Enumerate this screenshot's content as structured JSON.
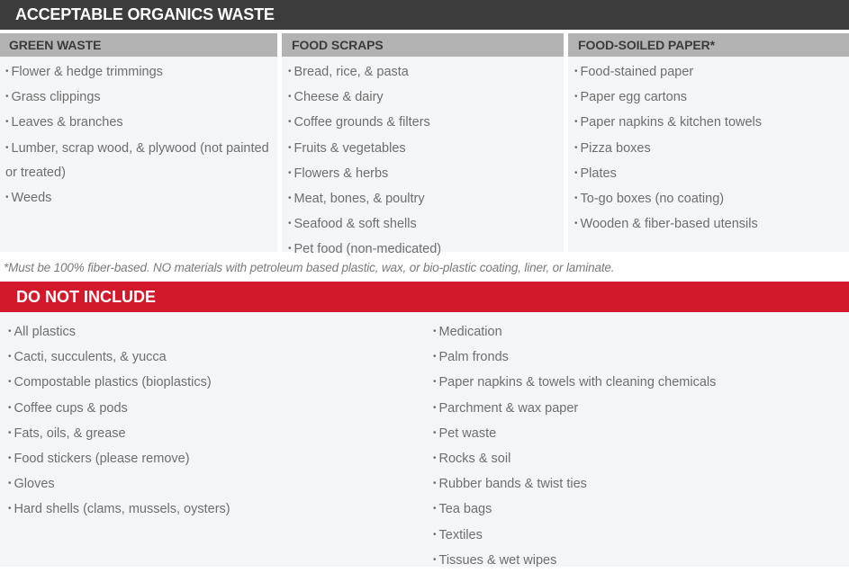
{
  "acceptable": {
    "title": "ACCEPTABLE ORGANICS WASTE",
    "header_color": "#3c3c3c",
    "columns": [
      {
        "heading": "GREEN WASTE",
        "items": [
          "Flower & hedge trimmings",
          "Grass clippings",
          "Leaves & branches",
          "Lumber, scrap wood, & plywood (not painted or treated)",
          "Weeds"
        ]
      },
      {
        "heading": "FOOD SCRAPS",
        "items": [
          "Bread, rice, & pasta",
          "Cheese & dairy",
          "Coffee grounds & filters",
          "Fruits & vegetables",
          "Flowers & herbs",
          "Meat, bones, & poultry",
          "Seafood & soft shells",
          "Pet food (non-medicated)"
        ]
      },
      {
        "heading": "FOOD-SOILED PAPER*",
        "items": [
          "Food-stained paper",
          "Paper egg cartons",
          "Paper napkins & kitchen towels",
          "Pizza boxes",
          "Plates",
          "To-go boxes (no coating)",
          "Wooden & fiber-based utensils"
        ]
      }
    ],
    "footnote": "*Must be 100% fiber-based. NO materials with petroleum based plastic, wax, or bio-plastic coating, liner, or laminate."
  },
  "do_not_include": {
    "title": "DO NOT INCLUDE",
    "header_color": "#d2192b",
    "left_items": [
      "All plastics",
      "Cacti, succulents, & yucca",
      "Compostable plastics (bioplastics)",
      "Coffee cups & pods",
      "Fats, oils, & grease",
      "Food stickers (please remove)",
      "Gloves",
      "Hard shells (clams, mussels, oysters)"
    ],
    "right_items": [
      "Medication",
      "Palm fronds",
      "Paper napkins & towels with cleaning chemicals",
      "Parchment & wax paper",
      "Pet waste",
      "Rocks & soil",
      "Rubber bands & twist ties",
      "Tea bags",
      "Textiles",
      "Tissues & wet wipes"
    ]
  },
  "bullet_glyph": "•"
}
